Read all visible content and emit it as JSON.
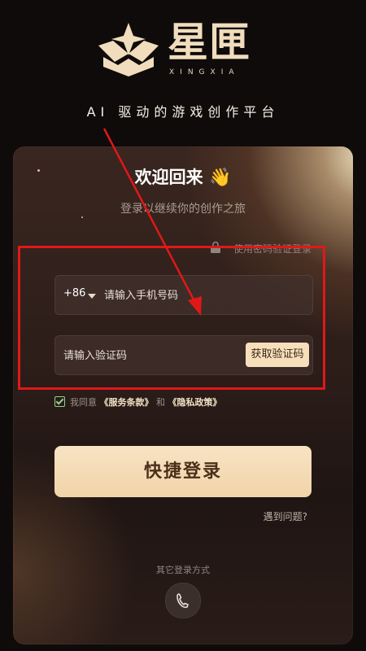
{
  "brand": {
    "name": "星匣",
    "subname": "XINGXIA",
    "tagline": "AI 驱动的游戏创作平台"
  },
  "card": {
    "welcome": "欢迎回来",
    "wave_emoji": "👋",
    "subtitle": "登录以继续你的创作之旅",
    "password_login": "使用密码验证登录",
    "phone": {
      "country_code": "+86",
      "placeholder": "请输入手机号码"
    },
    "code": {
      "placeholder": "请输入验证码",
      "get_code_label": "获取验证码"
    },
    "agreement": {
      "prefix": "我同意",
      "terms": "《服务条款》",
      "and": "和",
      "privacy": "《隐私政策》",
      "checked": true
    },
    "login_button": "快捷登录",
    "trouble": "遇到问题?",
    "other_methods": "其它登录方式"
  },
  "colors": {
    "accent": "#f6dfba",
    "highlight": "#e01818",
    "background": "#0f0b0a"
  },
  "icons": [
    "logo-box-icon",
    "lock-icon",
    "chevron-down-icon",
    "checkbox-icon",
    "phone-handset-icon",
    "annotation-arrow"
  ]
}
